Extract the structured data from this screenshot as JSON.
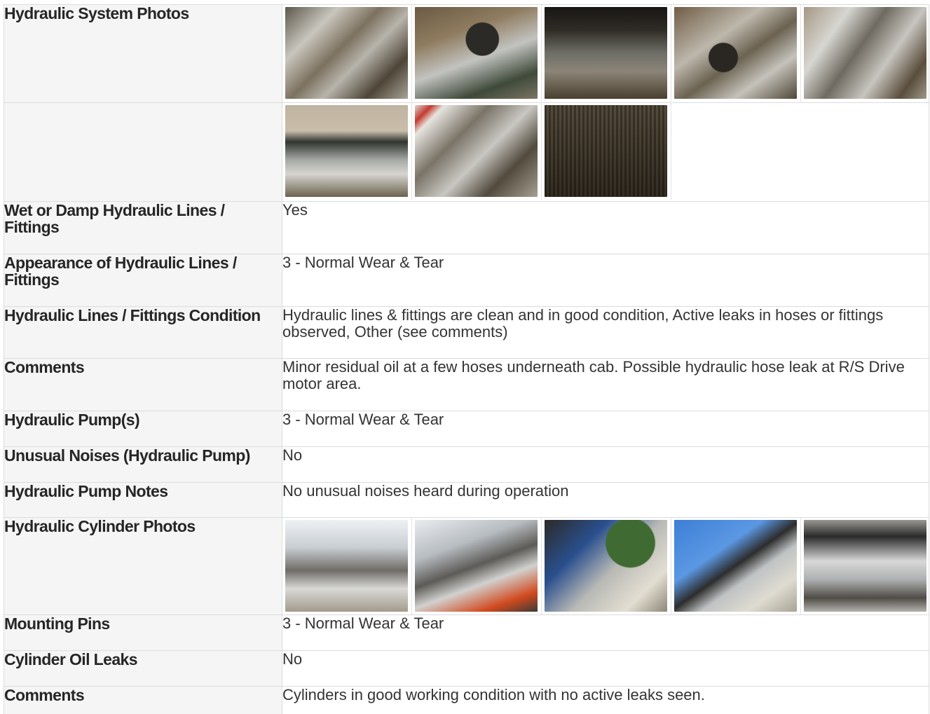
{
  "rows": {
    "hydraulic_system_photos": {
      "label": "Hydraulic System Photos",
      "photos": [
        "photo-1",
        "photo-2",
        "photo-3",
        "photo-4",
        "photo-5",
        "photo-6",
        "photo-7",
        "photo-8"
      ]
    },
    "wet_damp_lines": {
      "label": "Wet or Damp Hydraulic Lines / Fittings",
      "value": "Yes"
    },
    "appearance_lines": {
      "label": "Appearance of Hydraulic Lines / Fittings",
      "value": "3 - Normal Wear & Tear"
    },
    "lines_condition": {
      "label": "Hydraulic Lines / Fittings Condition",
      "value": "Hydraulic lines & fittings are clean and in good condition, Active leaks in hoses or fittings observed, Other (see comments)"
    },
    "comments_1": {
      "label": "Comments",
      "value": "Minor residual oil at a few hoses underneath cab. Possible hydraulic hose leak at R/S Drive motor area."
    },
    "hydraulic_pumps": {
      "label": "Hydraulic Pump(s)",
      "value": "3 - Normal Wear & Tear"
    },
    "unusual_noises": {
      "label": "Unusual Noises (Hydraulic Pump)",
      "value": "No"
    },
    "pump_notes": {
      "label": "Hydraulic Pump Notes",
      "value": "No unusual noises heard during operation"
    },
    "cylinder_photos": {
      "label": "Hydraulic Cylinder Photos",
      "photos": [
        "photo-1",
        "photo-2",
        "photo-3",
        "photo-4",
        "photo-5"
      ]
    },
    "mounting_pins": {
      "label": "Mounting Pins",
      "value": "3 - Normal Wear & Tear"
    },
    "cylinder_oil_leaks": {
      "label": "Cylinder Oil Leaks",
      "value": "No"
    },
    "comments_2": {
      "label": "Comments",
      "value": "Cylinders in good working condition with no active leaks seen."
    }
  },
  "colors": {
    "label_background": "#f5f5f5",
    "border": "#dcdcdc",
    "section_accent": "#1a73c8"
  }
}
